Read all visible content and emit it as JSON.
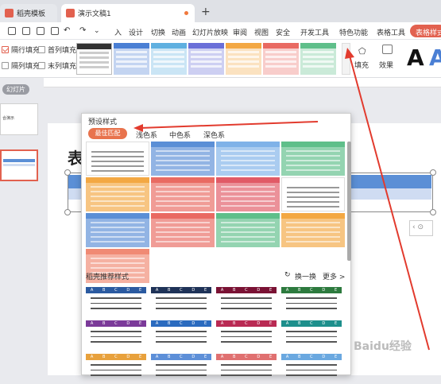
{
  "tabs": [
    {
      "label": "稻壳模板"
    },
    {
      "label": "演示文稿1"
    }
  ],
  "menu": [
    "入",
    "设计",
    "切换",
    "动画",
    "幻灯片放映",
    "审阅",
    "视图",
    "安全",
    "开发工具",
    "特色功能",
    "表格工具"
  ],
  "table_style_button": "表格样式",
  "ribbon": {
    "checkboxes": [
      {
        "label": "隔行填充",
        "checked": true
      },
      {
        "label": "首列填充",
        "checked": false
      },
      {
        "label": "隔列填充",
        "checked": false
      },
      {
        "label": "末列填充",
        "checked": false
      }
    ],
    "fill_label": "填充",
    "effect_label": "效果",
    "gallery_colors": [
      "#333333",
      "#4a7fd4",
      "#5fb0e0",
      "#6a6fd8",
      "#f3a843",
      "#e96a62",
      "#5fbf8a"
    ]
  },
  "left_pane": {
    "label": "幻灯片",
    "thumb_text": "合演示"
  },
  "slide": {
    "title_char": "表"
  },
  "popup": {
    "title": "预设样式",
    "tabs": [
      {
        "label": "最佳匹配"
      },
      {
        "label": "浅色系"
      },
      {
        "label": "中色系"
      },
      {
        "label": "深色系"
      }
    ],
    "grid_colors": [
      [
        "#ffffff",
        "#5b8fd6",
        "#7fb2e8",
        "#5fbf8a"
      ],
      [
        "#f3a843",
        "#e96a62",
        "#e15a66",
        "#ffffff"
      ],
      [
        "#5b8fd6",
        "#e96a62",
        "#5fbf8a",
        "#f3a843"
      ],
      [
        "#f08a74"
      ]
    ],
    "recommend_title": "稻壳推荐样式",
    "refresh_label": "换一换",
    "more_label": "更多 >",
    "rec_letters": [
      "A",
      "B",
      "C",
      "D",
      "E"
    ],
    "rec_colors": [
      "#2b5aa0",
      "#1f3358",
      "#7a1234",
      "#2d7a3e",
      "#7b3a99",
      "#2b6bbf",
      "#b92a53",
      "#1d8f8c",
      "#e8a13c",
      "#5d8fd8",
      "#e07070",
      "#6aa8e0"
    ]
  },
  "watermark": "Baidu经验"
}
